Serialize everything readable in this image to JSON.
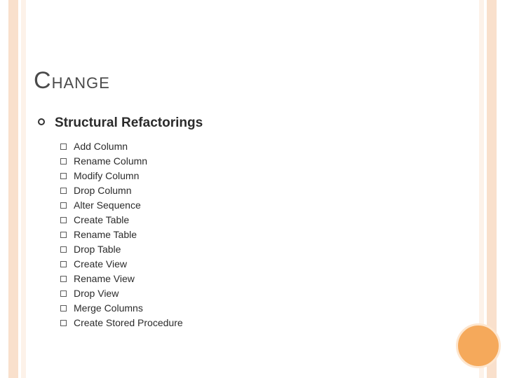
{
  "title": {
    "cap": "C",
    "rest": "HANGE"
  },
  "section": {
    "heading": "Structural Refactorings"
  },
  "items": [
    {
      "label": "Add Column"
    },
    {
      "label": "Rename Column"
    },
    {
      "label": "Modify Column"
    },
    {
      "label": "Drop Column"
    },
    {
      "label": "Alter Sequence"
    },
    {
      "label": "Create Table"
    },
    {
      "label": "Rename Table"
    },
    {
      "label": "Drop Table"
    },
    {
      "label": "Create View"
    },
    {
      "label": "Rename View"
    },
    {
      "label": "Drop View"
    },
    {
      "label": "Merge Columns"
    },
    {
      "label": "Create Stored Procedure"
    }
  ]
}
